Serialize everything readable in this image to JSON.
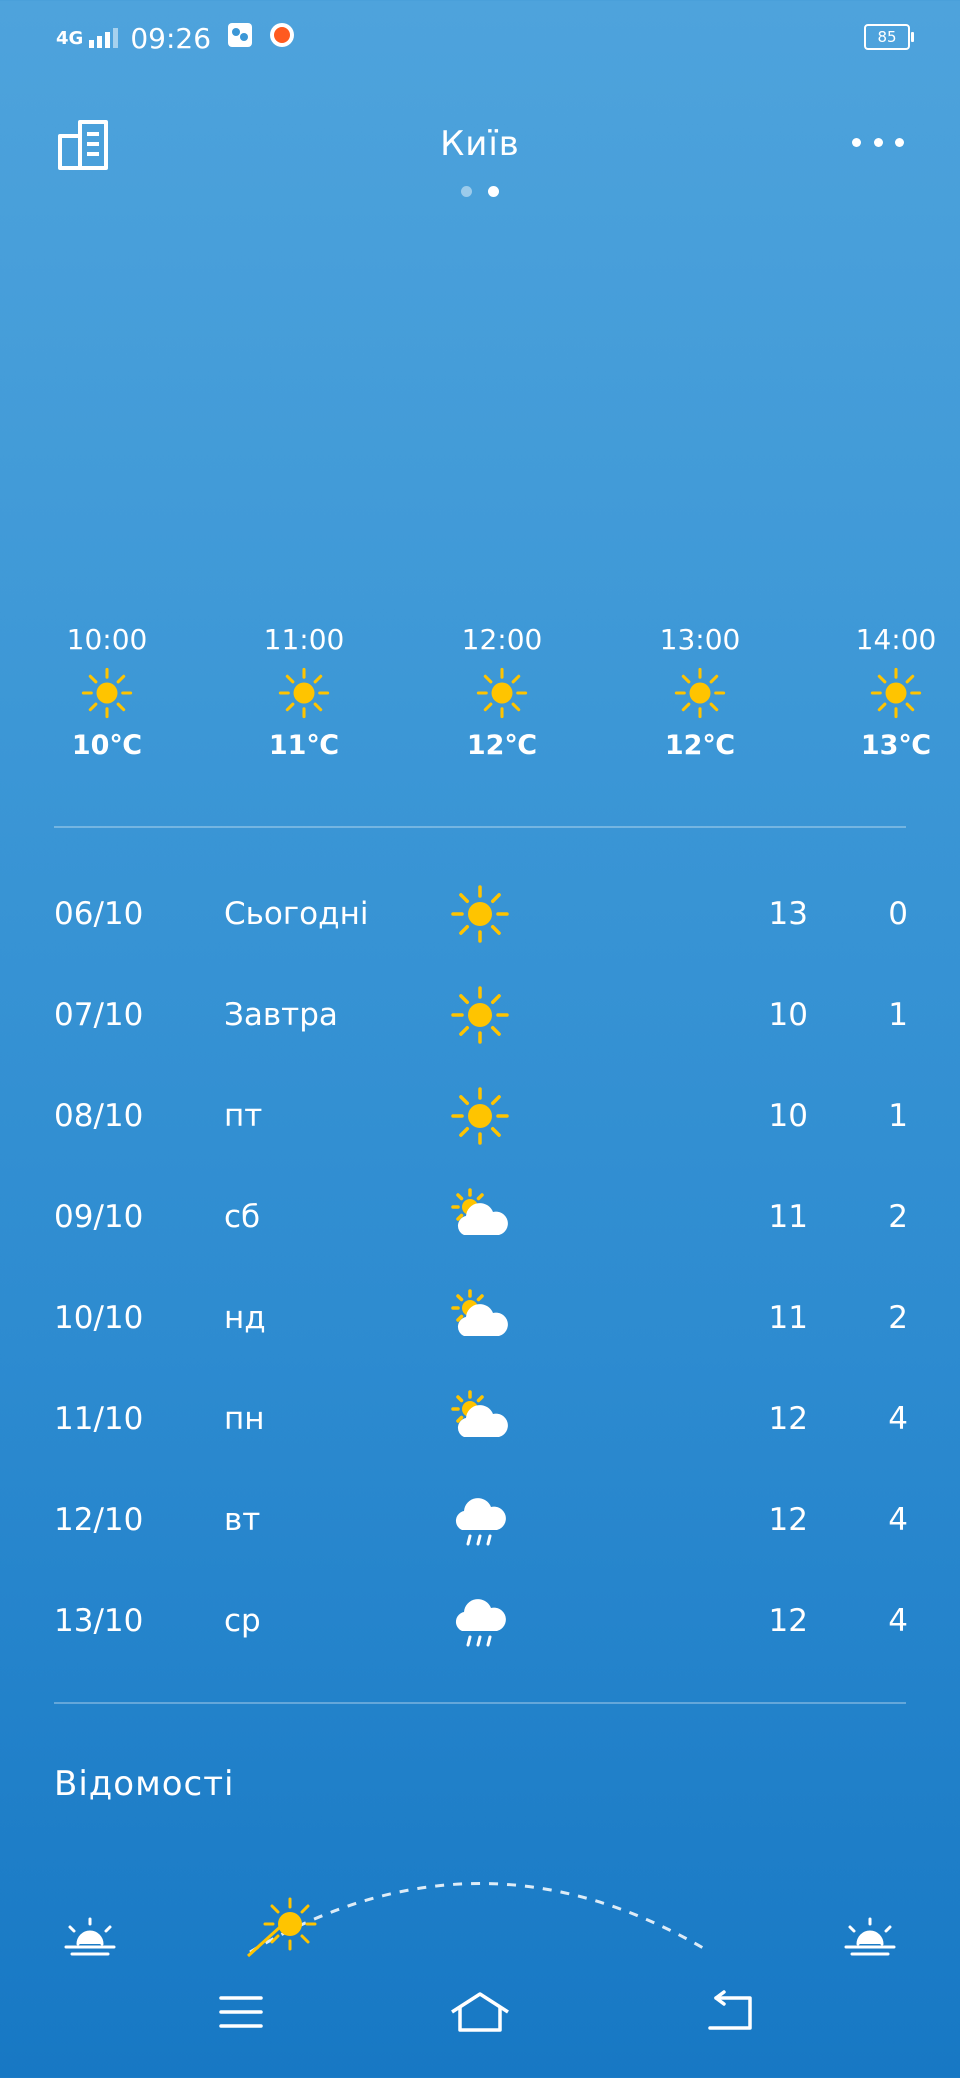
{
  "status": {
    "network": "4G",
    "time": "09:26",
    "battery": "85"
  },
  "header": {
    "city": "Київ",
    "pages": 2,
    "active_page": 2
  },
  "hourly": [
    {
      "time": "10:00",
      "icon": "sun-icon",
      "temp": "10℃"
    },
    {
      "time": "11:00",
      "icon": "sun-icon",
      "temp": "11℃"
    },
    {
      "time": "12:00",
      "icon": "sun-icon",
      "temp": "12℃"
    },
    {
      "time": "13:00",
      "icon": "sun-icon",
      "temp": "12℃"
    },
    {
      "time": "14:00",
      "icon": "sun-icon",
      "temp": "13℃"
    }
  ],
  "daily": [
    {
      "date": "06/10",
      "day": "Сьогодні",
      "icon": "sun-icon",
      "hi": "13",
      "lo": "0"
    },
    {
      "date": "07/10",
      "day": "Завтра",
      "icon": "sun-icon",
      "hi": "10",
      "lo": "1"
    },
    {
      "date": "08/10",
      "day": "пт",
      "icon": "sun-icon",
      "hi": "10",
      "lo": "1"
    },
    {
      "date": "09/10",
      "day": "сб",
      "icon": "partly-cloudy-icon",
      "hi": "11",
      "lo": "2"
    },
    {
      "date": "10/10",
      "day": "нд",
      "icon": "partly-cloudy-icon",
      "hi": "11",
      "lo": "2"
    },
    {
      "date": "11/10",
      "day": "пн",
      "icon": "partly-cloudy-icon",
      "hi": "12",
      "lo": "4"
    },
    {
      "date": "12/10",
      "day": "вт",
      "icon": "rain-cloud-icon",
      "hi": "12",
      "lo": "4"
    },
    {
      "date": "13/10",
      "day": "ср",
      "icon": "rain-cloud-icon",
      "hi": "12",
      "lo": "4"
    }
  ],
  "details": {
    "title": "Відомості"
  },
  "colors": {
    "sun": "#ffc400",
    "bg_top": "#4ea3dc",
    "bg_bottom": "#1778c4"
  }
}
